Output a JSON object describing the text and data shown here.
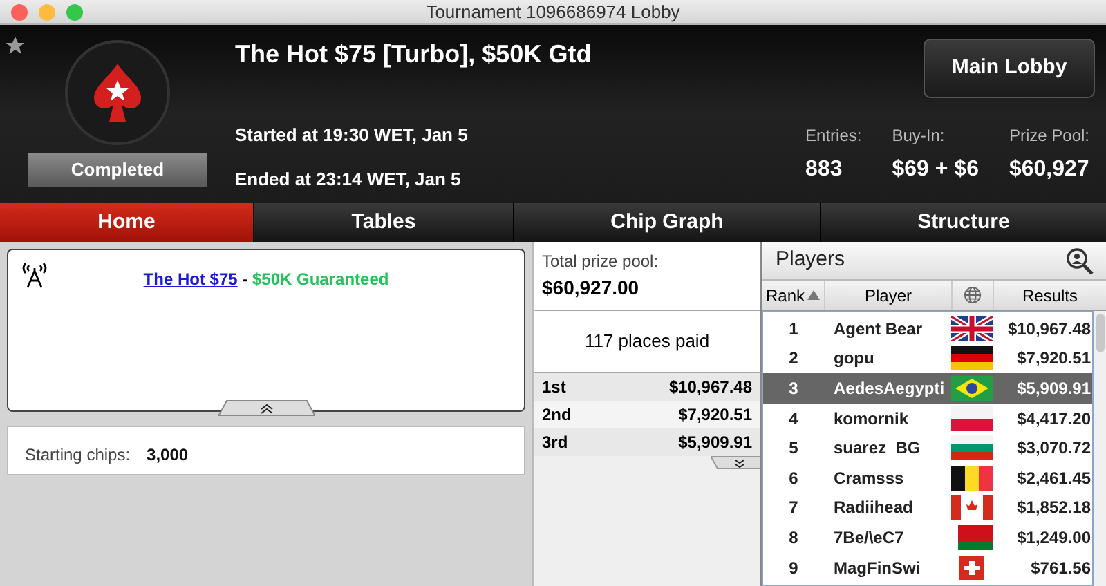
{
  "window": {
    "title": "Tournament 1096686974 Lobby"
  },
  "header": {
    "title": "The Hot $75 [Turbo], $50K Gtd",
    "status": "Completed",
    "started": "Started at 19:30 WET, Jan 5",
    "ended": "Ended at 23:14 WET, Jan 5",
    "main_lobby_button": "Main Lobby",
    "stats": [
      {
        "label": "Entries:",
        "value": "883"
      },
      {
        "label": "Buy-In:",
        "value": "$69 + $6"
      },
      {
        "label": "Prize Pool:",
        "value": "$60,927"
      }
    ]
  },
  "tabs": [
    {
      "label": "Home",
      "selected": true
    },
    {
      "label": "Tables",
      "selected": false
    },
    {
      "label": "Chip Graph",
      "selected": false
    },
    {
      "label": "Structure",
      "selected": false
    }
  ],
  "info": {
    "link": "The Hot $75",
    "separator": "-",
    "guarantee": "$50K Guaranteed",
    "starting_chips_label": "Starting chips:",
    "starting_chips": "3,000"
  },
  "prizes": {
    "total_label": "Total prize pool:",
    "total": "$60,927.00",
    "places_paid": "117 places paid",
    "rows": [
      {
        "place": "1st",
        "amount": "$10,967.48"
      },
      {
        "place": "2nd",
        "amount": "$7,920.51"
      },
      {
        "place": "3rd",
        "amount": "$5,909.91"
      }
    ]
  },
  "players": {
    "title": "Players",
    "columns": [
      "Rank",
      "Player",
      "Results"
    ],
    "rows": [
      {
        "rank": "1",
        "name": "Agent Bear",
        "kind": "uk",
        "result": "$10,967.48",
        "selected": false
      },
      {
        "rank": "2",
        "name": "gopu",
        "kind": "de",
        "result": "$7,920.51",
        "selected": false
      },
      {
        "rank": "3",
        "name": "AedesAegypti",
        "kind": "br",
        "result": "$5,909.91",
        "selected": true
      },
      {
        "rank": "4",
        "name": "komornik",
        "kind": "pl",
        "result": "$4,417.20",
        "selected": false
      },
      {
        "rank": "5",
        "name": "suarez_BG",
        "kind": "bg",
        "result": "$3,070.72",
        "selected": false
      },
      {
        "rank": "6",
        "name": "Cramsss",
        "kind": "be",
        "result": "$2,461.45",
        "selected": false
      },
      {
        "rank": "7",
        "name": "Radiihead",
        "kind": "ca",
        "result": "$1,852.18",
        "selected": false
      },
      {
        "rank": "8",
        "name": "7Be/\\eC7",
        "kind": "by",
        "result": "$1,249.00",
        "selected": false
      },
      {
        "rank": "9",
        "name": "MagFinSwi",
        "kind": "ch",
        "result": "$761.56",
        "selected": false
      }
    ]
  }
}
